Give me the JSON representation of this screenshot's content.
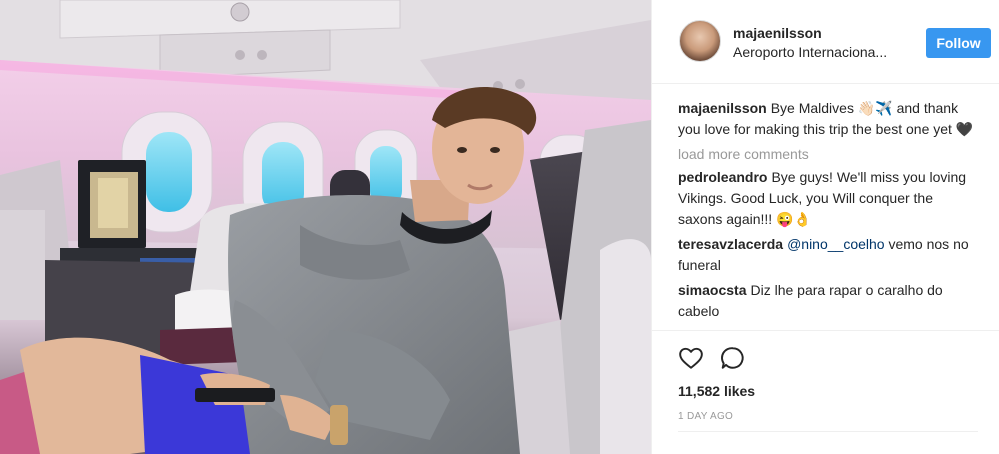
{
  "post": {
    "username": "majaenilsson",
    "location": "Aeroporto Internaciona...",
    "follow_label": "Follow",
    "caption_user": "majaenilsson",
    "caption_text": "Bye Maldives 👋🏻✈️ and thank you love for making this trip the best one yet 🖤",
    "load_more_label": "load more comments",
    "likes": "11,582 likes",
    "date": "1 DAY AGO"
  },
  "comments": [
    {
      "user": "pedroleandro",
      "text": "Bye guys! We'll miss you loving Vikings. Good Luck, you Will conquer the saxons again!!! 😜👌"
    },
    {
      "user": "teresavzlacerda",
      "mention": "@nino__coelho",
      "text": " vemo nos no funeral"
    },
    {
      "user": "simaocsta",
      "text": "Diz lhe para rapar o caralho do cabelo"
    }
  ],
  "icons": {
    "like": "heart-outline-icon",
    "comment": "comment-bubble-icon"
  },
  "colors": {
    "follow_button": "#3897f0",
    "secondary_text": "#999999",
    "mention": "#003569"
  }
}
